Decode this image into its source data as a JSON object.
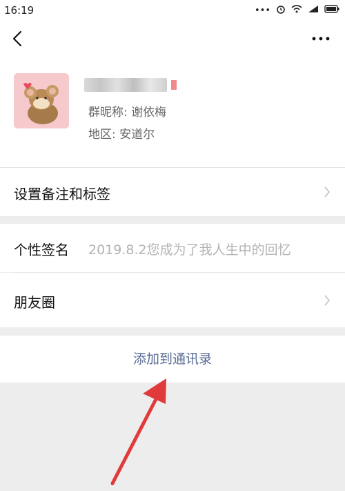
{
  "status": {
    "time": "16:19"
  },
  "profile": {
    "group_nickname": "群昵称: 谢依梅",
    "region": "地区: 安道尔"
  },
  "rows": {
    "remark": "设置备注和标签",
    "signature_label": "个性签名",
    "signature_value": "2019.8.2您成为了我人生中的回忆",
    "moments": "朋友圈"
  },
  "actions": {
    "add_contact": "添加到通讯录"
  },
  "colors": {
    "link": "#576b95",
    "annotation_arrow": "#e03a3a"
  },
  "icons": [
    "back-icon",
    "more-icon",
    "chevron-right-icon",
    "wifi-icon",
    "battery-icon",
    "alarm-icon",
    "signal-icon"
  ]
}
